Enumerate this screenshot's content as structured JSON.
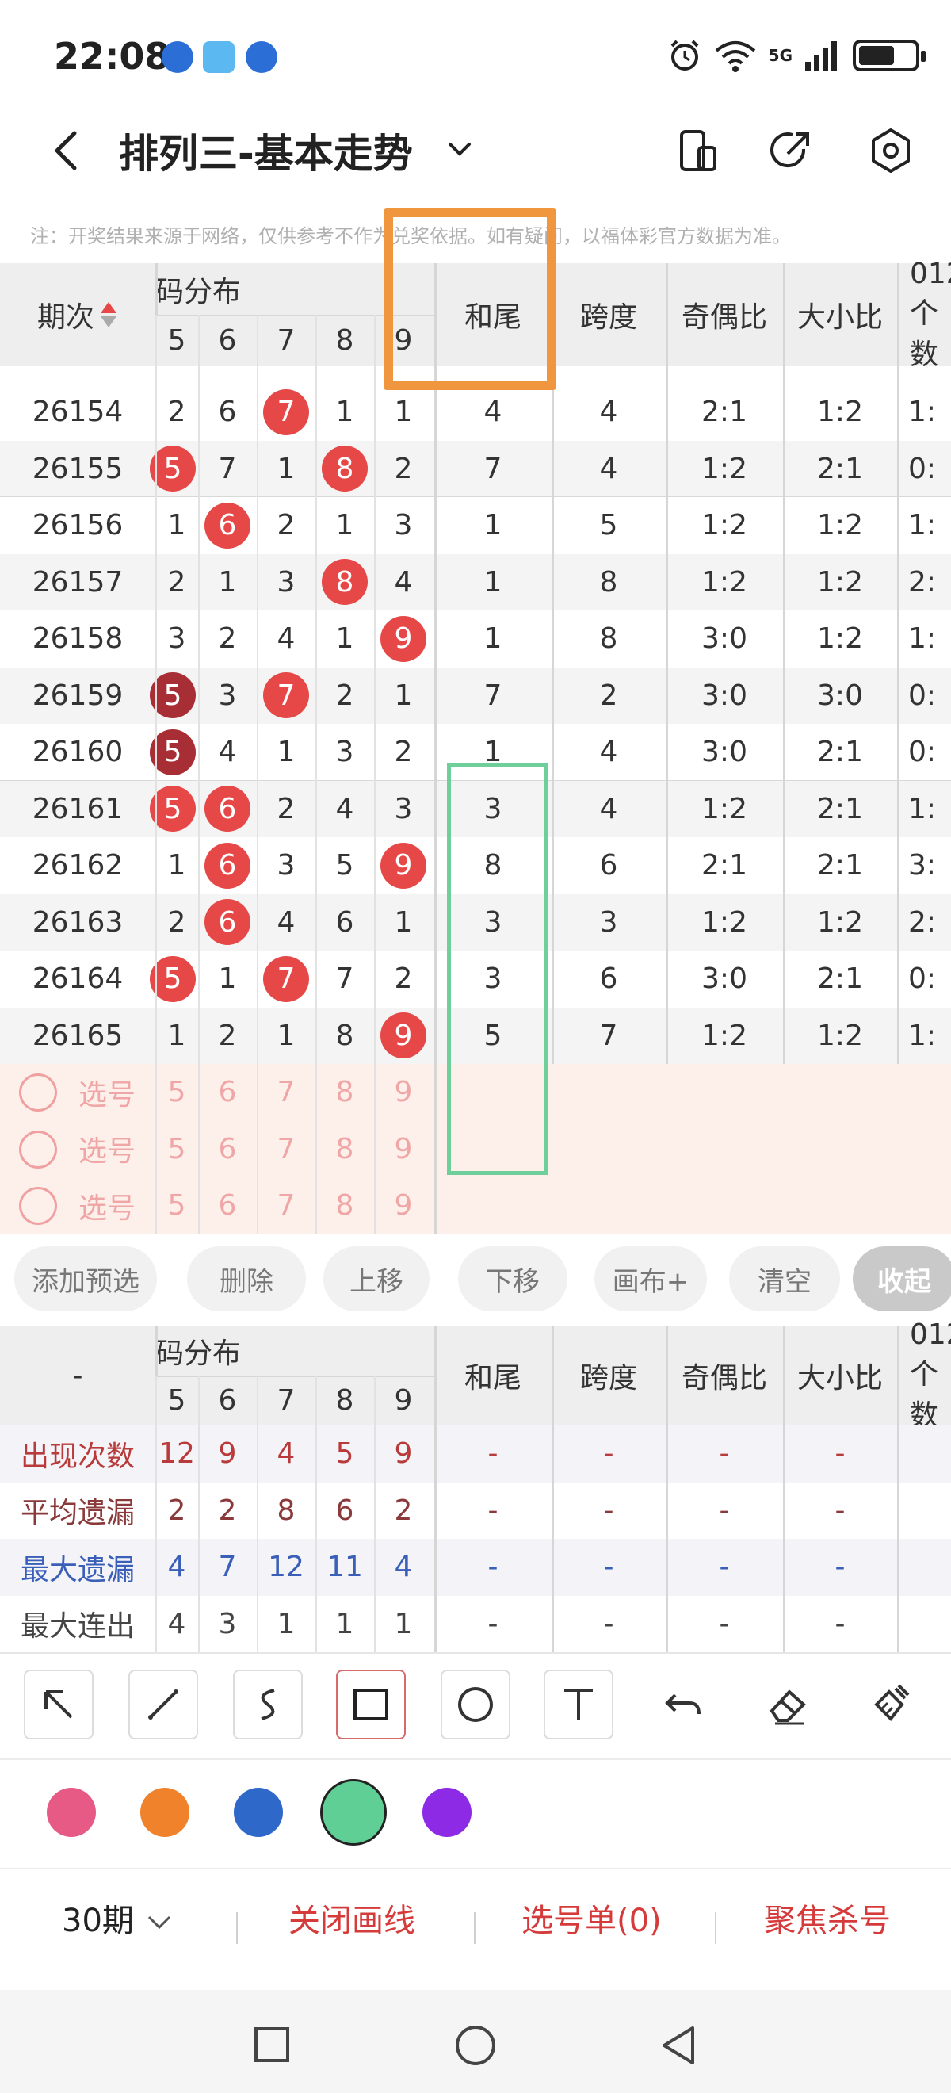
{
  "status": {
    "time": "22:08",
    "signal": "5G"
  },
  "header": {
    "title": "排列三-基本走势"
  },
  "notice": "注：开奖结果来源于网络，仅供参考不作为兑奖依据。如有疑问，以福体彩官方数据为准。",
  "columns": {
    "issue": "期次",
    "distribution": "码分布",
    "digits": [
      "5",
      "6",
      "7",
      "8",
      "9"
    ],
    "hewei": "和尾",
    "kuadu": "跨度",
    "jiou": "奇偶比",
    "daxiao": "大小比",
    "extra_top": "012",
    "extra_bottom": "个数"
  },
  "rows": [
    {
      "issue": "26154",
      "d": [
        "2",
        "6",
        "7",
        "1",
        "1"
      ],
      "ball": [
        false,
        false,
        true,
        false,
        false
      ],
      "hewei": "4",
      "kuadu": "4",
      "jiou": "2:1",
      "daxiao": "1:2",
      "extra": "1:"
    },
    {
      "issue": "26155",
      "d": [
        "5",
        "7",
        "1",
        "8",
        "2"
      ],
      "ball": [
        true,
        false,
        false,
        true,
        false
      ],
      "hewei": "7",
      "kuadu": "4",
      "jiou": "1:2",
      "daxiao": "2:1",
      "extra": "0:"
    },
    {
      "issue": "26156",
      "d": [
        "1",
        "6",
        "2",
        "1",
        "3"
      ],
      "ball": [
        false,
        true,
        false,
        false,
        false
      ],
      "hewei": "1",
      "kuadu": "5",
      "jiou": "1:2",
      "daxiao": "1:2",
      "extra": "1:"
    },
    {
      "issue": "26157",
      "d": [
        "2",
        "1",
        "3",
        "8",
        "4"
      ],
      "ball": [
        false,
        false,
        false,
        true,
        false
      ],
      "hewei": "1",
      "kuadu": "8",
      "jiou": "1:2",
      "daxiao": "1:2",
      "extra": "2:"
    },
    {
      "issue": "26158",
      "d": [
        "3",
        "2",
        "4",
        "1",
        "9"
      ],
      "ball": [
        false,
        false,
        false,
        false,
        true
      ],
      "hewei": "1",
      "kuadu": "8",
      "jiou": "3:0",
      "daxiao": "1:2",
      "extra": "1:"
    },
    {
      "issue": "26159",
      "d": [
        "5",
        "3",
        "7",
        "2",
        "1"
      ],
      "ball": [
        true,
        false,
        true,
        false,
        false
      ],
      "dark": [
        true,
        false,
        false,
        false,
        false
      ],
      "hewei": "7",
      "kuadu": "2",
      "jiou": "3:0",
      "daxiao": "3:0",
      "extra": "0:"
    },
    {
      "issue": "26160",
      "d": [
        "5",
        "4",
        "1",
        "3",
        "2"
      ],
      "ball": [
        true,
        false,
        false,
        false,
        false
      ],
      "dark": [
        true,
        false,
        false,
        false,
        false
      ],
      "hewei": "1",
      "kuadu": "4",
      "jiou": "3:0",
      "daxiao": "2:1",
      "extra": "0:"
    },
    {
      "issue": "26161",
      "d": [
        "5",
        "6",
        "2",
        "4",
        "3"
      ],
      "ball": [
        true,
        true,
        false,
        false,
        false
      ],
      "hewei": "3",
      "kuadu": "4",
      "jiou": "1:2",
      "daxiao": "2:1",
      "extra": "1:"
    },
    {
      "issue": "26162",
      "d": [
        "1",
        "6",
        "3",
        "5",
        "9"
      ],
      "ball": [
        false,
        true,
        false,
        false,
        true
      ],
      "hewei": "8",
      "kuadu": "6",
      "jiou": "2:1",
      "daxiao": "2:1",
      "extra": "3:"
    },
    {
      "issue": "26163",
      "d": [
        "2",
        "6",
        "4",
        "6",
        "1"
      ],
      "ball": [
        false,
        true,
        false,
        false,
        false
      ],
      "hewei": "3",
      "kuadu": "3",
      "jiou": "1:2",
      "daxiao": "1:2",
      "extra": "2:"
    },
    {
      "issue": "26164",
      "d": [
        "5",
        "1",
        "7",
        "7",
        "2"
      ],
      "ball": [
        true,
        false,
        true,
        false,
        false
      ],
      "hewei": "3",
      "kuadu": "6",
      "jiou": "3:0",
      "daxiao": "2:1",
      "extra": "0:"
    },
    {
      "issue": "26165",
      "d": [
        "1",
        "2",
        "1",
        "8",
        "9"
      ],
      "ball": [
        false,
        false,
        false,
        false,
        true
      ],
      "hewei": "5",
      "kuadu": "7",
      "jiou": "1:2",
      "daxiao": "1:2",
      "extra": "1:"
    }
  ],
  "pick_label": "选号",
  "pick_digits": [
    "5",
    "6",
    "7",
    "8",
    "9"
  ],
  "actions": [
    "添加预选",
    "删除",
    "上移",
    "下移",
    "画布+",
    "清空",
    "收起"
  ],
  "stats_header": "-",
  "stats": [
    {
      "label": "出现次数",
      "vals": [
        "12",
        "9",
        "4",
        "5",
        "9"
      ],
      "color": "#b83a3a"
    },
    {
      "label": "平均遗漏",
      "vals": [
        "2",
        "2",
        "8",
        "6",
        "2"
      ],
      "color": "#8a3a3a"
    },
    {
      "label": "最大遗漏",
      "vals": [
        "4",
        "7",
        "12",
        "11",
        "4"
      ],
      "color": "#3a5fb8"
    },
    {
      "label": "最大连出",
      "vals": [
        "4",
        "3",
        "1",
        "1",
        "1"
      ],
      "color": "#444444"
    }
  ],
  "dash": "-",
  "colors": {
    "pink": "#e85a86",
    "orange": "#f0822c",
    "blue": "#2e68c8",
    "green": "#5fcf96",
    "purple": "#8d2ae6",
    "accent_red": "#d63b3b",
    "orange_box": "#f0963e",
    "green_box": "#6fcf9a"
  },
  "bottom": {
    "period": "30期",
    "close_lines": "关闭画线",
    "selection": "选号单(0)",
    "focus": "聚焦杀号"
  }
}
